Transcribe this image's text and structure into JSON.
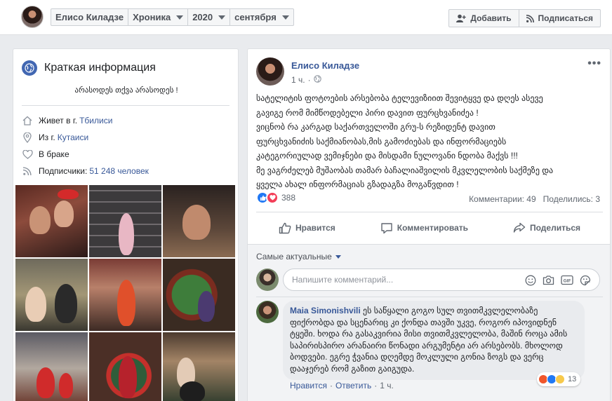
{
  "header": {
    "profile_name": "Елисо Киладзе",
    "section": "Хроника",
    "year": "2020",
    "month": "сентября",
    "add_label": "Добавить",
    "subscribe_label": "Подписаться"
  },
  "about": {
    "title": "Краткая информация",
    "bio": "არასოდეს თქვა არასოდეს !",
    "lives_prefix": "Живет в г.",
    "lives_city": "Тбилиси",
    "from_prefix": "Из г.",
    "from_city": "Кутаиси",
    "relationship": "В браке",
    "followers_prefix": "Подписчики:",
    "followers_count": "51 248 человек"
  },
  "post": {
    "author": "Елисо Киладзе",
    "time": "1 ч.",
    "more": "•••",
    "lines": [
      "სატელიტის ფოტოების არსებობა ტელევიზიით შევიტყვე და დღეს ასევე",
      "გავიგე რომ მიმწოდებელი პირი დავით ფურცხვანიძეა !",
      "ვიცნობ რა კარგად საქართველოში გრუ-ს რეზიდენტ დავით",
      "ფურცხვანიძის საქმიანობას,მის გამოძიებას და ინფორმაციებს",
      "კატეგორიულად ვემიჯნები და მისდამი ნულოვანი ნდობა მაქვს !!!",
      "მე ვაგრძელებ მუშაობას თამარ ბაჩალიაშვილის მკვლელობის საქმეზე და",
      "ყველა ახალ ინფორმაციას გზადაგზა მოგაწვდით !"
    ],
    "reaction_count": "388",
    "comments_stat": "Комментарии: 49",
    "shares_stat": "Поделились: 3",
    "like_label": "Нравится",
    "comment_label": "Комментировать",
    "share_label": "Поделиться"
  },
  "comments": {
    "sort_label": "Самые актуальные",
    "input_placeholder": "Напишите комментарий...",
    "items": [
      {
        "author": "Maia Simonishvili",
        "text": "ეს საწყალი გოგო სულ თვითმკვლელობაზე ფიქრობდა და სცენარიც კი ქონდა თავში უკვე, როგორ იპოვიდნენ ტყეში. ხოდა რა გასაკვირია მისი თვითმკვლელობა, მაშინ როცა ამის საპირისპირო არანაირი წონადი არგუმენტი არ არსებობს. მხოლოდ ბოდვები. ეგრე ჭვანია დღემდე მოკლული გონია ზოგს და ვერც დააჯერებ რომ გაზით გაიგუდა.",
        "like_label": "Нравится",
        "reply_label": "Ответить",
        "time": "1 ч.",
        "reaction_count": "13"
      }
    ]
  },
  "colors": {
    "link": "#385898",
    "like_blue": "#2078f4",
    "love_red": "#f33e58",
    "background": "#e9ebee"
  }
}
